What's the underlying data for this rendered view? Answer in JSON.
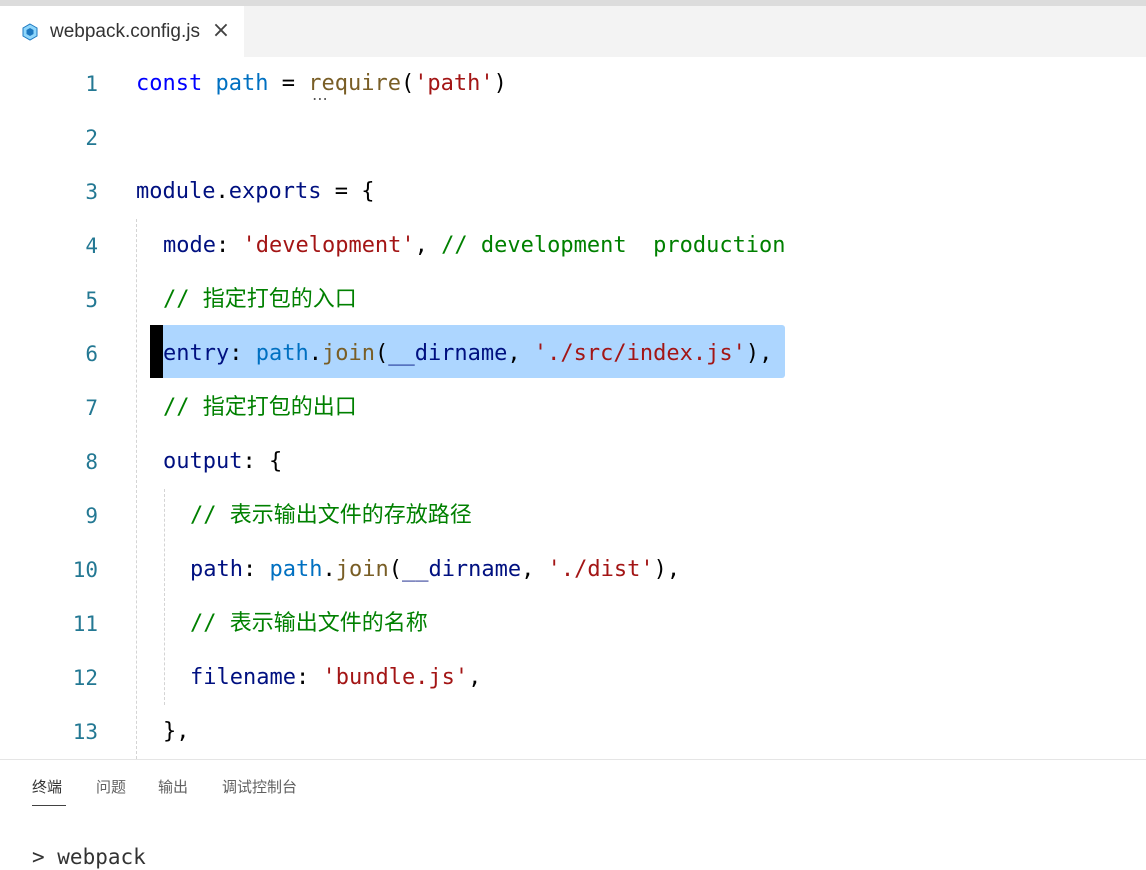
{
  "tab": {
    "filename": "webpack.config.js",
    "close": "×",
    "icon": "webpack-cube-icon"
  },
  "editor": {
    "line_numbers": [
      "1",
      "2",
      "3",
      "4",
      "5",
      "6",
      "7",
      "8",
      "9",
      "10",
      "11",
      "12",
      "13"
    ],
    "lines": {
      "l1": {
        "kw": "const",
        "name": "path",
        "eq": " = ",
        "fn": "require",
        "open": "(",
        "str": "'path'",
        "close": ")"
      },
      "l3": {
        "module": "module",
        "dot": ".",
        "exports": "exports",
        "rest": " = {"
      },
      "l4": {
        "key": "mode",
        "colon": ": ",
        "str": "'development'",
        "comma": ", ",
        "comment": "// development  production"
      },
      "l5": {
        "comment": "// 指定打包的入口"
      },
      "l6": {
        "key": "entry",
        "colon": ": ",
        "obj": "path",
        "dot": ".",
        "fn": "join",
        "open": "(",
        "arg": "__dirname",
        "sep": ", ",
        "str": "'./src/index.js'",
        "close": "),"
      },
      "l7": {
        "comment": "// 指定打包的出口"
      },
      "l8": {
        "key": "output",
        "rest": ": {"
      },
      "l9": {
        "comment": "// 表示输出文件的存放路径"
      },
      "l10": {
        "key": "path",
        "colon": ": ",
        "obj": "path",
        "dot": ".",
        "fn": "join",
        "open": "(",
        "arg": "__dirname",
        "sep": ", ",
        "str": "'./dist'",
        "close": "),"
      },
      "l11": {
        "comment": "// 表示输出文件的名称"
      },
      "l12": {
        "key": "filename",
        "colon": ": ",
        "str": "'bundle.js'",
        "comma": ","
      },
      "l13": {
        "text": "},"
      }
    },
    "hover_dots": "⋯"
  },
  "panel": {
    "tabs": [
      "终端",
      "问题",
      "输出",
      "调试控制台"
    ],
    "active_tab": "终端",
    "terminal_line": "> webpack"
  },
  "colors": {
    "selection": "#add6ff",
    "line_number": "#237893",
    "comment": "#008000",
    "string": "#a31515"
  }
}
